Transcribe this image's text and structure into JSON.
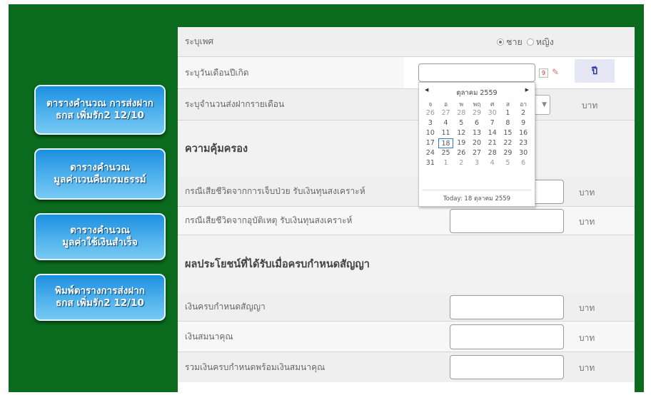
{
  "sidebar": {
    "items": [
      {
        "label": "ตารางคำนวณ การส่งฝาก\nธกส เพิ่มรัก2 12/10"
      },
      {
        "label": "ตารางคำนวณ\nมูลค่าเวนคืนกรมธรรม์"
      },
      {
        "label": "ตารางคำนวณ\nมูลค่าใช้เงินสำเร็จ"
      },
      {
        "label": "พิมพ์ตารางการส่งฝาก\nธกส เพิ่มรัก2 12/10"
      }
    ]
  },
  "form": {
    "gender_label": "ระบุเพศ",
    "gender_male": "ชาย",
    "gender_female": "หญิง",
    "birthdate_label": "ระบุวันเดือนปีเกิด",
    "birthdate_value": "",
    "calendar_icon_text": "9",
    "year_button": "ปี",
    "monthly_label": "ระบุจำนวนส่งฝากรายเดือน",
    "currency_unit": "บาท",
    "section_protection": "ความคุ้มครอง",
    "illness_label": "กรณีเสียชีวิตจากการเจ็บป่วย รับเงินทุนสงเคราะห์",
    "accident_label": "กรณีเสียชีวิตจากอุบัติเหตุ รับเงินทุนสงเคราะห์",
    "section_benefit": "ผลประโยชน์ที่ได้รับเมื่อครบกำหนดสัญญา",
    "maturity_label": "เงินครบกำหนดสัญญา",
    "gratuity_label": "เงินสมนาคุณ",
    "total_label": "รวมเงินครบกำหนดพร้อมเงินสมนาคุณ"
  },
  "calendar": {
    "title": "ตุลาคม 2559",
    "prev": "◀",
    "next": "▶",
    "dow": [
      "จ",
      "อ",
      "พ",
      "พฤ",
      "ศ",
      "ส",
      "อา"
    ],
    "weeks": [
      [
        "26",
        "27",
        "28",
        "29",
        "30",
        "1",
        "2"
      ],
      [
        "3",
        "4",
        "5",
        "6",
        "7",
        "8",
        "9"
      ],
      [
        "10",
        "11",
        "12",
        "13",
        "14",
        "15",
        "16"
      ],
      [
        "17",
        "18",
        "19",
        "20",
        "21",
        "22",
        "23"
      ],
      [
        "24",
        "25",
        "26",
        "27",
        "28",
        "29",
        "30"
      ],
      [
        "31",
        "1",
        "2",
        "3",
        "4",
        "5",
        "6"
      ]
    ],
    "today_footer": "Today: 18 ตุลาคม 2559"
  },
  "colors": {
    "frame_green": "#0a6a1d",
    "button_blue": "#4fb2ec",
    "year_button_text": "#2a3aa0"
  }
}
